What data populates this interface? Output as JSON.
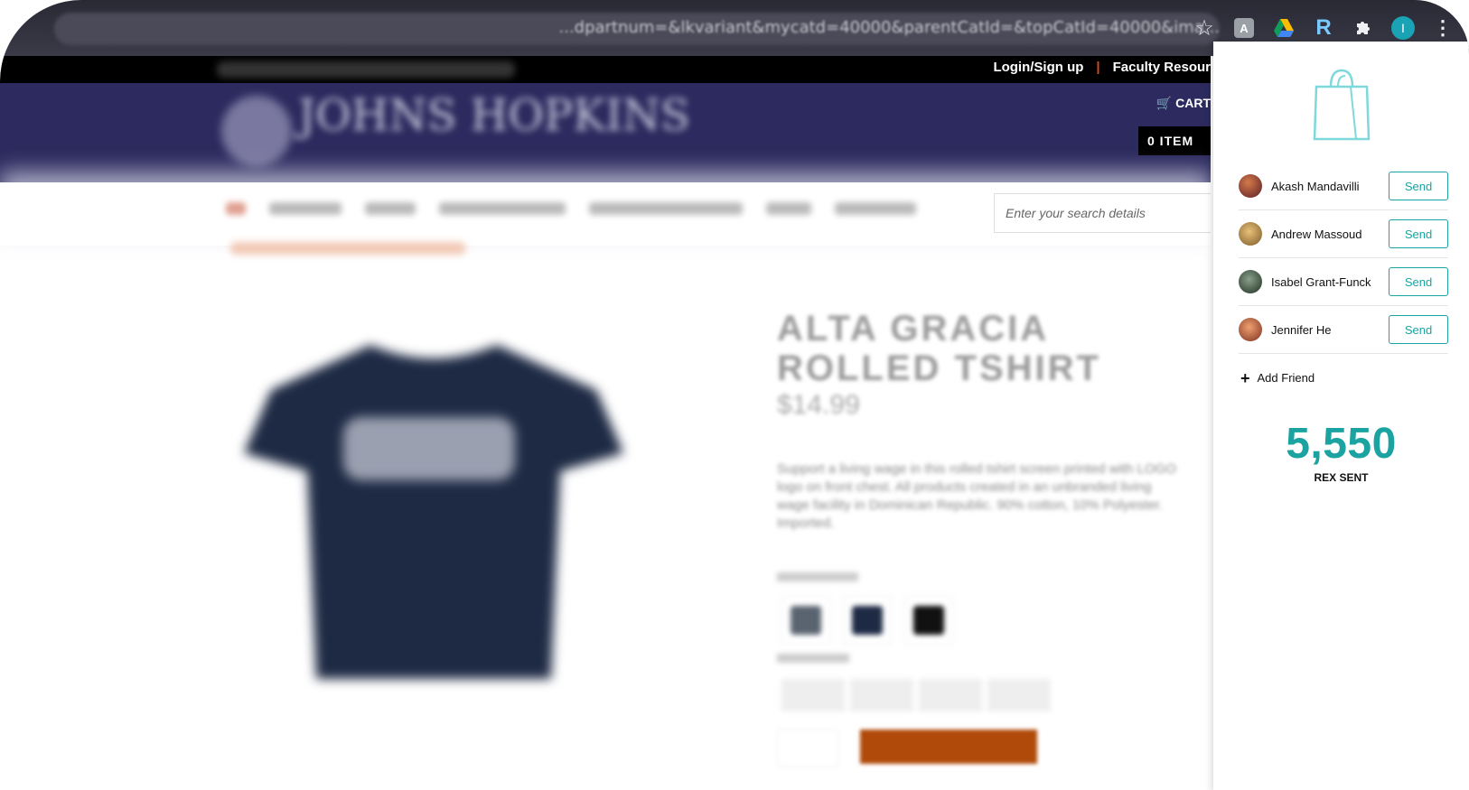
{
  "browser": {
    "url": "...dpartnum=&lkvariant&mycatd=40000&parentCatId=&topCatId=40000&ima...",
    "profile_initial": "I",
    "ext_r_label": "R",
    "ext_a_label": "A"
  },
  "site": {
    "top_links": [
      "Login/Sign up",
      "Faculty Resour"
    ],
    "cart_label": "CART",
    "cart_items": "0 ITEM",
    "logo_text": "JOHNS HOPKINS",
    "search_placeholder": "Enter your search details",
    "product_title_line1": "ALTA GRACIA",
    "product_title_line2": "ROLLED TSHIRT",
    "price": "$14.99",
    "description": "Support a living wage in this rolled tshirt screen printed with LOGO logo on front chest. All products created in an unbranded living wage facility in Dominican Republic. 90% cotton, 10% Polyester. Imported."
  },
  "extension": {
    "friends": [
      {
        "name": "Akash Mandavilli",
        "action": "Send",
        "avatar_color": "#8a3b2a"
      },
      {
        "name": "Andrew Massoud",
        "action": "Send",
        "avatar_color": "#b88a3a"
      },
      {
        "name": "Isabel Grant-Funck",
        "action": "Send",
        "avatar_color": "#3f5a3a"
      },
      {
        "name": "Jennifer He",
        "action": "Send",
        "avatar_color": "#c0704a"
      }
    ],
    "add_friend_label": "Add Friend",
    "rex_count": "5,550",
    "rex_label": "REX SENT",
    "accent_color": "#1aa3a0"
  }
}
